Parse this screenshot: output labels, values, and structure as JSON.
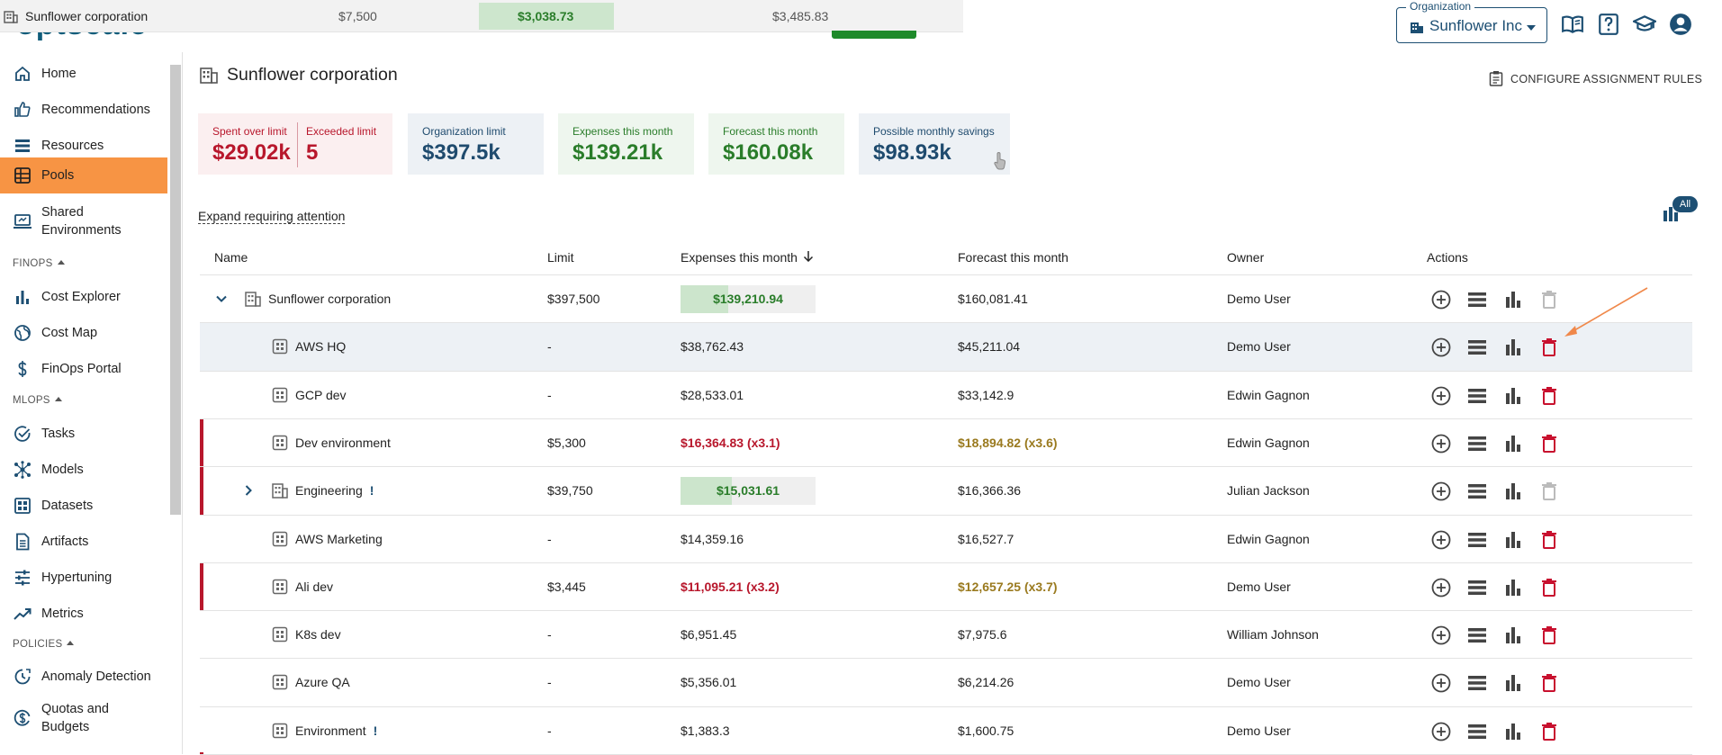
{
  "tooltip": {
    "title": "Sunflower corporation",
    "limit": "$7,500",
    "expenses": "$3,038.73",
    "forecast": "$3,485.83"
  },
  "header": {
    "org_label": "Organization",
    "org_value": "Sunflower Inc",
    "icons": [
      "documentation-icon",
      "help-icon",
      "academy-icon",
      "account-icon"
    ]
  },
  "sidebar": {
    "items": [
      {
        "label": "Home",
        "icon": "home-icon"
      },
      {
        "label": "Recommendations",
        "icon": "thumb-up-icon"
      },
      {
        "label": "Resources",
        "icon": "list-icon"
      },
      {
        "label": "Pools",
        "icon": "pools-icon",
        "active": true
      },
      {
        "label": "Shared Environments",
        "icon": "environment-icon"
      }
    ],
    "finops_label": "FINOPS",
    "finops_items": [
      {
        "label": "Cost Explorer",
        "icon": "bar-chart-icon"
      },
      {
        "label": "Cost Map",
        "icon": "globe-icon"
      },
      {
        "label": "FinOps Portal",
        "icon": "dollar-icon"
      }
    ],
    "mlops_label": "MLOPS",
    "mlops_items": [
      {
        "label": "Tasks",
        "icon": "check-circle-icon"
      },
      {
        "label": "Models",
        "icon": "hub-icon"
      },
      {
        "label": "Datasets",
        "icon": "dataset-icon"
      },
      {
        "label": "Artifacts",
        "icon": "article-icon"
      },
      {
        "label": "Hypertuning",
        "icon": "tune-icon"
      },
      {
        "label": "Metrics",
        "icon": "trending-icon"
      }
    ],
    "policies_label": "POLICIES",
    "policies_items": [
      {
        "label": "Anomaly Detection",
        "icon": "anomaly-icon"
      },
      {
        "label": "Quotas and Budgets",
        "icon": "budget-icon"
      }
    ]
  },
  "main": {
    "title": "Sunflower corporation",
    "configure_label": "CONFIGURE ASSIGNMENT RULES",
    "cards": {
      "spent_label": "Spent over limit",
      "spent_value": "$29.02k",
      "exceeded_label": "Exceeded limit",
      "exceeded_value": "5",
      "org_limit_label": "Organization limit",
      "org_limit_value": "$397.5k",
      "expenses_label": "Expenses this month",
      "expenses_value": "$139.21k",
      "forecast_label": "Forecast this month",
      "forecast_value": "$160.08k",
      "savings_label": "Possible monthly savings",
      "savings_value": "$98.93k"
    },
    "expand_link": "Expand requiring attention",
    "all_badge": "All"
  },
  "table": {
    "columns": {
      "name": "Name",
      "limit": "Limit",
      "expenses": "Expenses this month",
      "forecast": "Forecast this month",
      "owner": "Owner",
      "actions": "Actions"
    },
    "rows": [
      {
        "name": "Sunflower corporation",
        "limit": "$397,500",
        "expenses": "$139,210.94",
        "expenses_fill": 0.35,
        "forecast": "$160,081.41",
        "owner": "Demo User",
        "level": 0,
        "expand": "expanded",
        "attention": false,
        "warn": false,
        "over": false,
        "delete_enabled": false,
        "highlight": false
      },
      {
        "name": "AWS HQ",
        "limit": "-",
        "expenses": "$38,762.43",
        "forecast": "$45,211.04",
        "owner": "Demo User",
        "level": 1,
        "expand": "none",
        "attention": false,
        "warn": false,
        "over": false,
        "delete_enabled": true,
        "highlight": true
      },
      {
        "name": "GCP dev",
        "limit": "-",
        "expenses": "$28,533.01",
        "forecast": "$33,142.9",
        "owner": "Edwin Gagnon",
        "level": 1,
        "expand": "none",
        "attention": false,
        "warn": false,
        "over": false,
        "delete_enabled": true,
        "highlight": false
      },
      {
        "name": "Dev environment",
        "limit": "$5,300",
        "expenses": "$16,364.83 (x3.1)",
        "forecast": "$18,894.82 (x3.6)",
        "owner": "Edwin Gagnon",
        "level": 1,
        "expand": "none",
        "attention": true,
        "warn": false,
        "over": true,
        "delete_enabled": true,
        "highlight": false
      },
      {
        "name": "Engineering",
        "limit": "$39,750",
        "expenses": "$15,031.61",
        "expenses_fill": 0.38,
        "forecast": "$16,366.36",
        "owner": "Julian Jackson",
        "level": 1,
        "expand": "collapsed",
        "attention": true,
        "warn": true,
        "over": false,
        "delete_enabled": false,
        "highlight": false
      },
      {
        "name": "AWS Marketing",
        "limit": "-",
        "expenses": "$14,359.16",
        "forecast": "$16,527.7",
        "owner": "Edwin Gagnon",
        "level": 1,
        "expand": "none",
        "attention": false,
        "warn": false,
        "over": false,
        "delete_enabled": true,
        "highlight": false
      },
      {
        "name": "Ali dev",
        "limit": "$3,445",
        "expenses": "$11,095.21 (x3.2)",
        "forecast": "$12,657.25 (x3.7)",
        "owner": "Demo User",
        "level": 1,
        "expand": "none",
        "attention": true,
        "warn": false,
        "over": true,
        "delete_enabled": true,
        "highlight": false
      },
      {
        "name": "K8s dev",
        "limit": "-",
        "expenses": "$6,951.45",
        "forecast": "$7,975.6",
        "owner": "William Johnson",
        "level": 1,
        "expand": "none",
        "attention": false,
        "warn": false,
        "over": false,
        "delete_enabled": true,
        "highlight": false
      },
      {
        "name": "Azure QA",
        "limit": "-",
        "expenses": "$5,356.01",
        "forecast": "$6,214.26",
        "owner": "Demo User",
        "level": 1,
        "expand": "none",
        "attention": false,
        "warn": false,
        "over": false,
        "delete_enabled": true,
        "highlight": false
      },
      {
        "name": "Environment",
        "limit": "-",
        "expenses": "$1,383.3",
        "forecast": "$1,600.75",
        "owner": "Demo User",
        "level": 1,
        "expand": "none",
        "attention": false,
        "warn": true,
        "over": false,
        "delete_enabled": true,
        "highlight": false
      }
    ],
    "warn_mark": "!"
  },
  "colors": {
    "accent": "#f79444",
    "primary": "#1d4f73",
    "danger": "#b8172c",
    "success": "#2a7d2a",
    "warning_text": "#9a7a1f",
    "annotation_arrow": "#f0884a"
  }
}
